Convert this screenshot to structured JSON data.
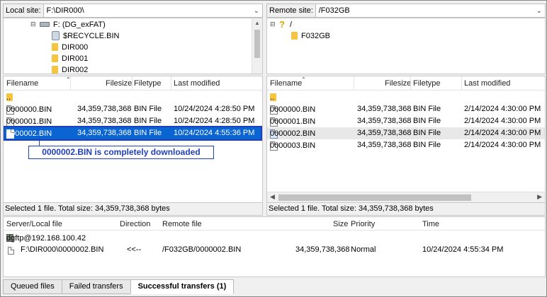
{
  "local": {
    "site_label": "Local site:",
    "site_path": "F:\\DIR000\\",
    "tree": [
      {
        "label": "F: (DG_exFAT)",
        "kind": "drive"
      },
      {
        "label": "$RECYCLE.BIN",
        "kind": "recycle"
      },
      {
        "label": "DIR000",
        "kind": "folder"
      },
      {
        "label": "DIR001",
        "kind": "folder"
      },
      {
        "label": "DIR002",
        "kind": "folder"
      }
    ],
    "columns": [
      "Filename",
      "Filesize",
      "Filetype",
      "Last modified"
    ],
    "files": [
      {
        "name": "..",
        "size": "",
        "type": "",
        "modified": "",
        "kind": "folder"
      },
      {
        "name": "0000000.BIN",
        "size": "34,359,738,368",
        "type": "BIN File",
        "modified": "10/24/2024 4:28:50 PM",
        "kind": "file"
      },
      {
        "name": "0000001.BIN",
        "size": "34,359,738,368",
        "type": "BIN File",
        "modified": "10/24/2024 4:28:50 PM",
        "kind": "file"
      },
      {
        "name": "0000002.BIN",
        "size": "34,359,738,368",
        "type": "BIN File",
        "modified": "10/24/2024 4:55:36 PM",
        "kind": "file",
        "selected": true
      }
    ],
    "status": "Selected 1 file. Total size: 34,359,738,368 bytes"
  },
  "remote": {
    "site_label": "Remote site:",
    "site_path": "/F032GB",
    "tree": [
      {
        "label": "/",
        "kind": "unknown"
      },
      {
        "label": "F032GB",
        "kind": "folder"
      }
    ],
    "columns": [
      "Filename",
      "Filesize",
      "Filetype",
      "Last modified"
    ],
    "files": [
      {
        "name": "..",
        "size": "",
        "type": "",
        "modified": "",
        "kind": "folder"
      },
      {
        "name": "0000000.BIN",
        "size": "34,359,738,368",
        "type": "BIN File",
        "modified": "2/14/2024 4:30:00 PM",
        "kind": "file"
      },
      {
        "name": "0000001.BIN",
        "size": "34,359,738,368",
        "type": "BIN File",
        "modified": "2/14/2024 4:30:00 PM",
        "kind": "file"
      },
      {
        "name": "0000002.BIN",
        "size": "34,359,738,368",
        "type": "BIN File",
        "modified": "2/14/2024 4:30:00 PM",
        "kind": "file",
        "highlighted": true
      },
      {
        "name": "0000003.BIN",
        "size": "34,359,738,368",
        "type": "BIN File",
        "modified": "2/14/2024 4:30:00 PM",
        "kind": "file"
      }
    ],
    "status": "Selected 1 file. Total size: 34,359,738,368 bytes"
  },
  "annotation": "0000002.BIN is completely downloaded",
  "queue": {
    "columns": [
      "Server/Local file",
      "Direction",
      "Remote file",
      "Size",
      "Priority",
      "Time"
    ],
    "server": "dgftp@192.168.100.42",
    "transfer": {
      "local_file": "F:\\DIR000\\0000002.BIN",
      "direction": "<<--",
      "remote_file": "/F032GB/0000002.BIN",
      "size": "34,359,738,368",
      "priority": "Normal",
      "time": "10/24/2024 4:55:34 PM"
    }
  },
  "tabs": [
    {
      "label": "Queued files",
      "active": false
    },
    {
      "label": "Failed transfers",
      "active": false
    },
    {
      "label": "Successful transfers (1)",
      "active": true
    }
  ],
  "colors": {
    "selection": "#0a64d2",
    "annotation": "#1f3fbd",
    "folder": "#f5c542"
  }
}
